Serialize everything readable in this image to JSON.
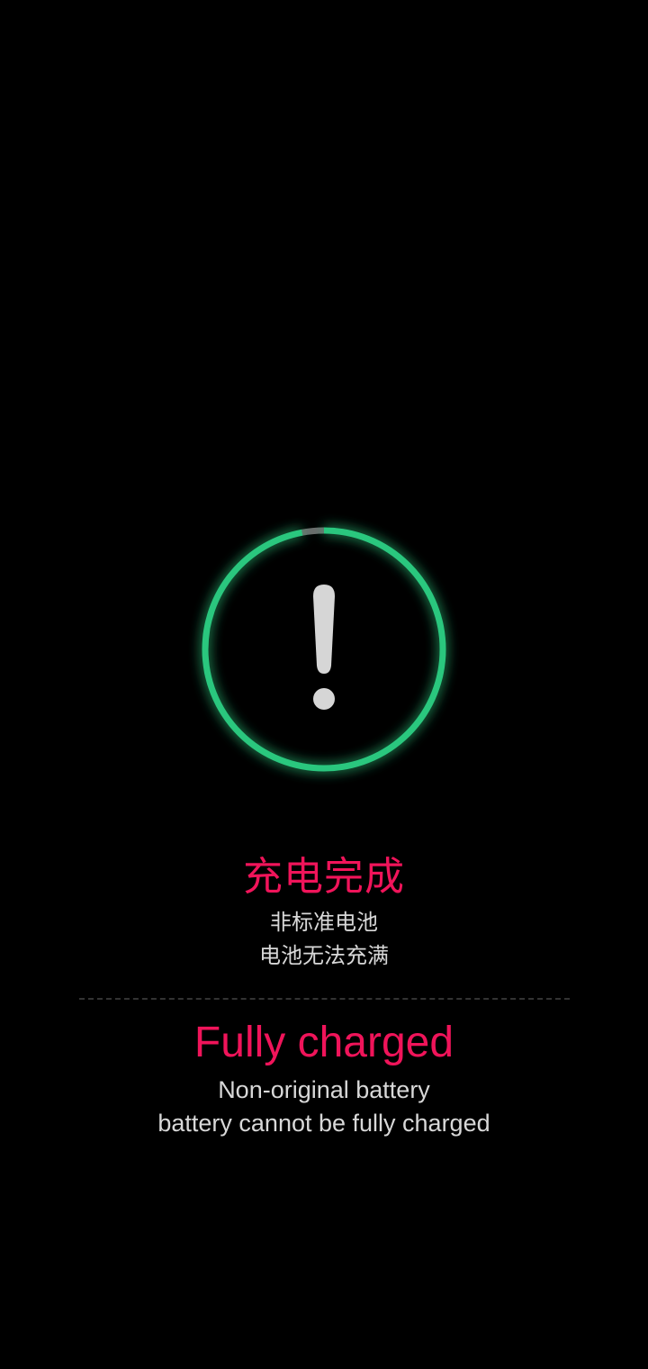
{
  "colors": {
    "background": "#000000",
    "ring": "#2bc77e",
    "ring_glow": "#1fbf74",
    "ring_gap": "#6b6b6b",
    "warning_glyph": "#d6d6d6",
    "title": "#f0145a",
    "body_text": "#d8d8d8",
    "divider": "#333333"
  },
  "charging_indicator": {
    "icon": "exclamation-icon",
    "ring_fill_fraction": 0.97
  },
  "status_cn": {
    "title": "充电完成",
    "line1": "非标准电池",
    "line2": "电池无法充满"
  },
  "status_en": {
    "title": "Fully charged",
    "line1": "Non-original battery",
    "line2": "battery cannot be fully charged"
  }
}
